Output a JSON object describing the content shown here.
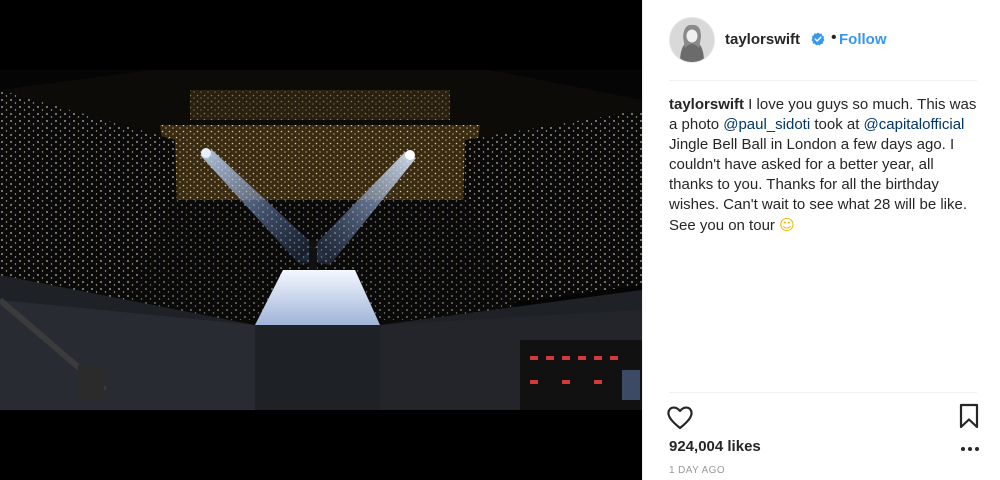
{
  "post": {
    "photo_alt": "Concert stage",
    "header": {
      "username": "taylorswift",
      "separator": "•",
      "follow_label": "Follow"
    },
    "caption": {
      "username": "taylorswift",
      "text_1": " I love you guys so much. This was a photo ",
      "mention_1": "@paul_sidoti",
      "text_2": " took at ",
      "mention_2": "@capitalofficial",
      "text_3": " Jingle Bell Ball in London a few days ago. I couldn't have asked for a better year, all thanks to you. Thanks for all the birthday wishes. Can't wait to see what 28 will be like. See you on tour ",
      "emoji": "☺"
    },
    "likes": "924,004 likes",
    "timestamp": "1 DAY AGO"
  },
  "colors": {
    "link_blue": "#3897f0",
    "mention_blue": "#003569",
    "verified_blue": "#3897f0",
    "muted": "#999999"
  },
  "icons": {
    "verified": "verified-badge-icon",
    "heart": "heart-icon",
    "bookmark": "bookmark-icon",
    "more": "more-options-icon"
  }
}
